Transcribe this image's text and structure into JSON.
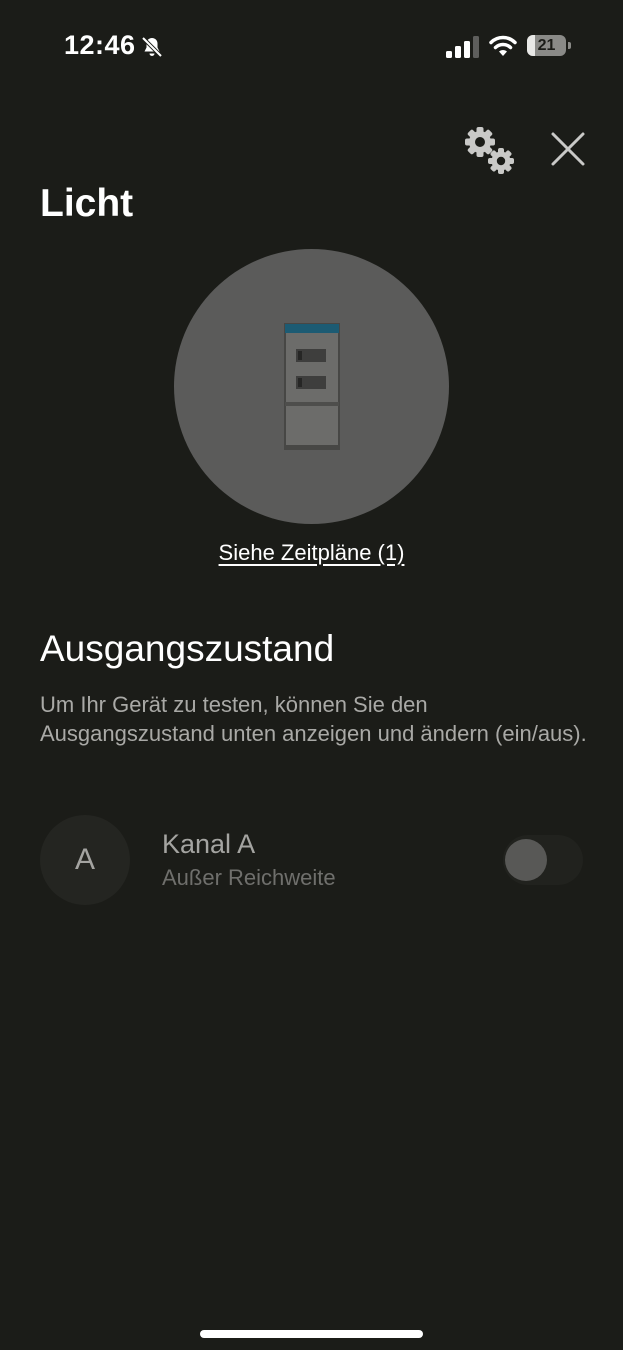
{
  "status_bar": {
    "time": "12:46",
    "battery_level": "21",
    "battery_fraction": 0.21,
    "signal_bars_active": 3,
    "icons": [
      "bell-slash-icon",
      "signal-icon",
      "wifi-icon",
      "battery-icon"
    ]
  },
  "header": {
    "settings_icon": "gears-icon",
    "close_icon": "close-icon"
  },
  "device": {
    "title": "Licht",
    "image_icon": "switch-cabinet-icon",
    "accent_color": "#1c5b73",
    "schedules_link": "Siehe Zeitpläne (1)"
  },
  "output_state": {
    "title": "Ausgangszustand",
    "description": "Um Ihr Gerät zu testen, können Sie den Ausgangszustand unten anzeigen und ändern (ein/aus).",
    "channels": [
      {
        "avatar": "A",
        "name": "Kanal A",
        "status": "Außer Reichweite",
        "on": false
      }
    ]
  }
}
